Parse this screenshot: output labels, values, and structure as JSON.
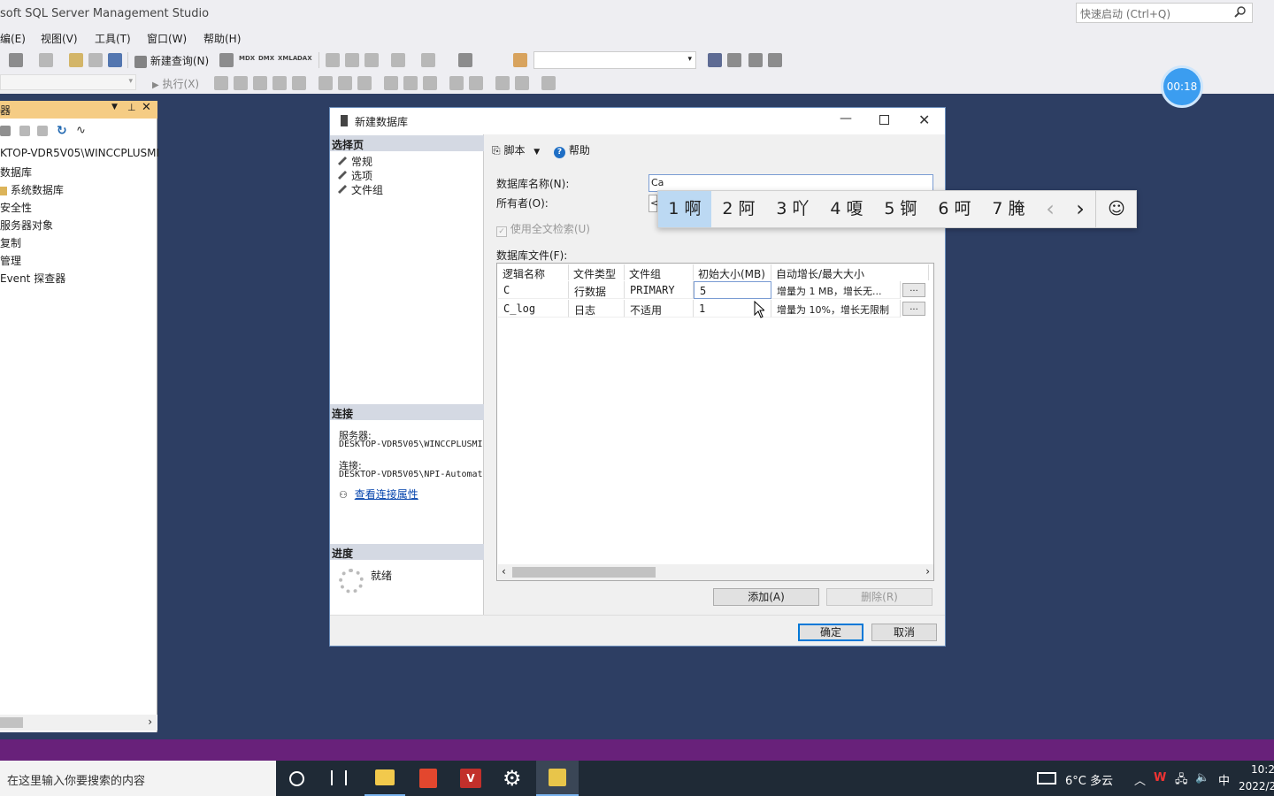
{
  "app": {
    "title": "soft SQL Server Management Studio"
  },
  "quick_launch": {
    "placeholder": "快速启动 (Ctrl+Q)"
  },
  "menu": [
    "编(E)",
    "视图(V)",
    "工具(T)",
    "窗口(W)",
    "帮助(H)"
  ],
  "toolbar": {
    "new_query": "新建查询(N)",
    "execute": "执行(X)",
    "icons": [
      "MDX",
      "DMX",
      "XMLA",
      "DAX"
    ]
  },
  "timer": "00:18",
  "object_explorer": {
    "title": "器",
    "items": [
      "KTOP-VDR5V05\\WINCCPLUSMI",
      "数据库",
      "系统数据库",
      "安全性",
      "服务器对象",
      "复制",
      "管理",
      "Event 探查器"
    ]
  },
  "dialog": {
    "title": "新建数据库",
    "select_page": {
      "header": "选择页",
      "pages": [
        "常规",
        "选项",
        "文件组"
      ]
    },
    "connection": {
      "header": "连接",
      "server_label": "服务器:",
      "server_value": "DESKTOP-VDR5V05\\WINCCPLUSMI",
      "conn_label": "连接:",
      "conn_value": "DESKTOP-VDR5V05\\NPI-Automat",
      "view_props": "查看连接属性"
    },
    "progress": {
      "header": "进度",
      "status": "就绪"
    },
    "toolbar": {
      "script": "脚本",
      "help": "帮助"
    },
    "db_name_label": "数据库名称(N):",
    "db_name_value": "Ca",
    "owner_label": "所有者(O):",
    "owner_value": "<",
    "fulltext_label": "使用全文检索(U)",
    "files_label": "数据库文件(F):",
    "columns": [
      "逻辑名称",
      "文件类型",
      "文件组",
      "初始大小(MB)",
      "自动增长/最大大小"
    ],
    "rows": [
      {
        "name": "C",
        "type": "行数据",
        "group": "PRIMARY",
        "size": "5",
        "growth": "增量为 1 MB，增长无..."
      },
      {
        "name": "C_log",
        "type": "日志",
        "group": "不适用",
        "size": "1",
        "growth": "增量为 10%，增长无限制"
      }
    ],
    "dots": "...",
    "add_button": "添加(A)",
    "remove_button": "删除(R)",
    "ok_button": "确定",
    "cancel_button": "取消"
  },
  "ime": {
    "candidates": [
      "1 啊",
      "2 阿",
      "3 吖",
      "4 嗄",
      "5 锕",
      "6 呵",
      "7 腌"
    ],
    "prev": "‹",
    "next": "›",
    "emoji": "☺"
  },
  "taskbar": {
    "search_placeholder": "在这里输入你要搜索的内容",
    "weather": "6°C 多云",
    "ime_indicator": "中",
    "time": "10:2",
    "date": "2022/2"
  }
}
